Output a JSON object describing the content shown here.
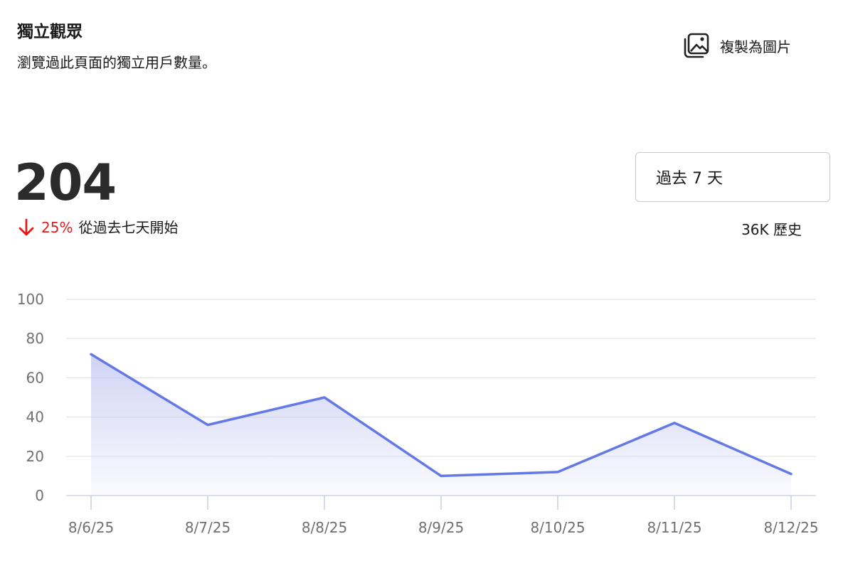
{
  "header": {
    "title": "獨立觀眾",
    "subtitle": "瀏覽過此頁面的獨立用戶數量。",
    "copy_label": "複製為圖片"
  },
  "kpi": {
    "value": "204",
    "delta_percent": "25%",
    "delta_direction": "down",
    "delta_since": "從過去七天開始",
    "delta_color": "#e01b1b"
  },
  "range": {
    "selected": "過去 7 天",
    "history": "36K 歷史"
  },
  "chart_data": {
    "type": "area",
    "categories": [
      "8/6/25",
      "8/7/25",
      "8/8/25",
      "8/9/25",
      "8/10/25",
      "8/11/25",
      "8/12/25"
    ],
    "values": [
      72,
      36,
      50,
      10,
      12,
      37,
      11
    ],
    "ylim": [
      0,
      100
    ],
    "yticks": [
      "0",
      "20",
      "40",
      "60",
      "80",
      "100"
    ],
    "grid": true,
    "line_color": "#6379e6",
    "fill_color": "#c7ccf2"
  }
}
